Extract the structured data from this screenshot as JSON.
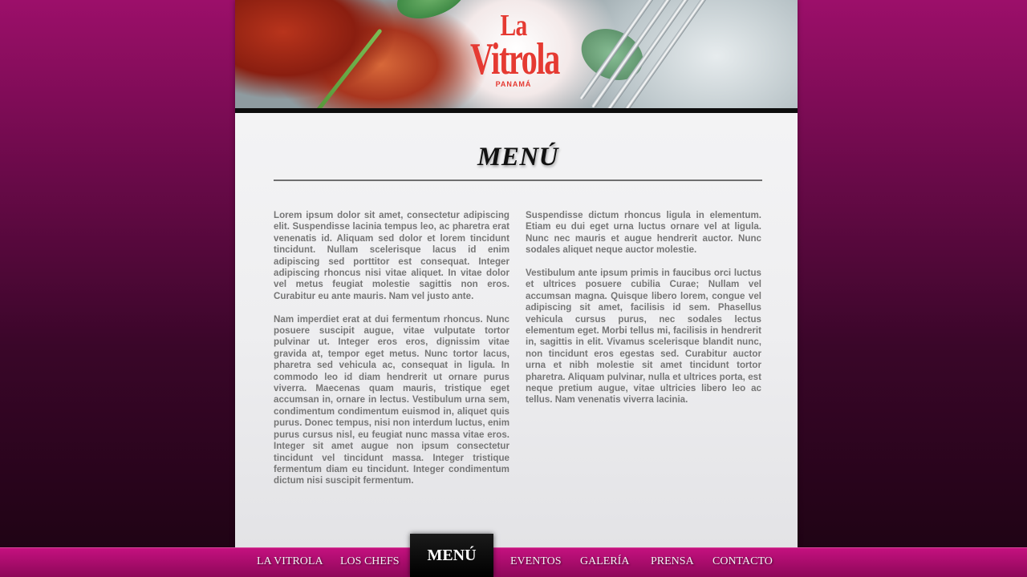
{
  "brand": {
    "logo_line1": "La",
    "logo_line2": "Vitrola",
    "logo_line3": "PANAMÁ",
    "logo_color": "#e53a32"
  },
  "page": {
    "title": "MENÚ"
  },
  "content": {
    "left_paragraphs": [
      "Lorem ipsum dolor sit amet, consectetur adipiscing elit. Suspendisse lacinia tempus leo, ac pharetra erat venenatis id. Aliquam sed dolor et lorem tincidunt tincidunt. Nullam scelerisque lacus id enim adipiscing sed porttitor est consequat. Integer adipiscing rhoncus nisi vitae aliquet. In vitae dolor vel metus feugiat molestie sagittis non eros. Curabitur eu ante mauris. Nam vel justo ante.",
      "Nam imperdiet erat at dui fermentum rhoncus. Nunc posuere suscipit augue, vitae vulputate tortor pulvinar ut. Integer eros eros, dignissim vitae gravida at, tempor eget metus. Nunc tortor lacus, pharetra sed vehicula ac, consequat in ligula. In commodo leo id diam hendrerit ut ornare purus viverra. Maecenas quam mauris, tristique eget accumsan in, ornare in lectus. Vestibulum urna sem, condimentum condimentum euismod in, aliquet quis purus. Donec tempus, nisi non interdum luctus, enim purus cursus nisl, eu feugiat nunc massa vitae eros. Integer sit amet augue non ipsum consectetur tincidunt vel tincidunt massa. Integer tristique fermentum diam eu tincidunt. Integer condimentum dictum nisi suscipit fermentum."
    ],
    "right_paragraphs": [
      "Suspendisse dictum rhoncus ligula in elementum. Etiam eu dui eget urna luctus ornare vel at ligula. Nunc nec mauris et augue hendrerit auctor. Nunc sodales aliquet neque auctor molestie.",
      "Vestibulum ante ipsum primis in faucibus orci luctus et ultrices posuere cubilia Curae; Nullam vel accumsan magna. Quisque libero lorem, congue vel adipiscing sit amet, facilisis id sem. Phasellus vehicula cursus purus, nec sodales lectus elementum eget. Morbi tellus mi, facilisis in hendrerit in, sagittis in elit. Vivamus scelerisque blandit nunc, non tincidunt eros egestas sed. Curabitur auctor urna et nibh molestie sit amet tincidunt tortor pharetra. Aliquam pulvinar, nulla et ultrices porta, est neque pretium augue, vitae ultricies libero leo ac tellus. Nam venenatis viverra lacinia."
    ]
  },
  "nav": {
    "items": [
      {
        "label": "LA VITROLA"
      },
      {
        "label": "LOS CHEFS"
      },
      {
        "label": "MENÚ",
        "active": true
      },
      {
        "label": "EVENTOS"
      },
      {
        "label": "GALERÍA"
      },
      {
        "label": "PRENSA"
      },
      {
        "label": "CONTACTO"
      }
    ],
    "bar_color": "#a90c6c",
    "active_color": "#000000"
  }
}
